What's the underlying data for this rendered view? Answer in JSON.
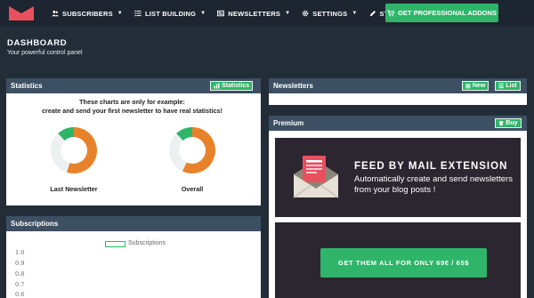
{
  "nav": {
    "items": [
      {
        "label": "SUBSCRIBERS",
        "icon": "users-icon",
        "has_caret": true
      },
      {
        "label": "LIST BUILDING",
        "icon": "list-icon",
        "has_caret": true
      },
      {
        "label": "NEWSLETTERS",
        "icon": "newspaper-icon",
        "has_caret": true
      },
      {
        "label": "SETTINGS",
        "icon": "gear-icon",
        "has_caret": true
      },
      {
        "label": "STATUS",
        "icon": "pencil-icon",
        "has_caret": false
      }
    ],
    "pro_button": "GET PROFESSIONAL ADDONS"
  },
  "header": {
    "title": "DASHBOARD",
    "subtitle": "Your powerful control panel"
  },
  "statistics": {
    "title": "Statistics",
    "button": "Statistics",
    "note_line1": "These charts are only for example:",
    "note_line2": "create and send your first newsletter to have real statistics!",
    "charts": [
      {
        "label": "Last Newsletter",
        "segments": [
          {
            "value": 0.55,
            "color": "#e8822a"
          },
          {
            "value": 0.33,
            "color": "#edf0f1"
          },
          {
            "value": 0.12,
            "color": "#2fb56a"
          }
        ]
      },
      {
        "label": "Overall",
        "segments": [
          {
            "value": 0.57,
            "color": "#e8822a"
          },
          {
            "value": 0.31,
            "color": "#edf0f1"
          },
          {
            "value": 0.12,
            "color": "#2fb56a"
          }
        ]
      }
    ]
  },
  "subscriptions": {
    "title": "Subscriptions",
    "legend": "Subscriptions",
    "yticks": [
      "1.0",
      "0.9",
      "0.8",
      "0.7",
      "0.6"
    ]
  },
  "newsletters": {
    "title": "Newsletters",
    "new_button": "New",
    "list_button": "List"
  },
  "premium": {
    "title": "Premium",
    "buy_button": "Buy",
    "promo_title": "FEED BY MAIL EXTENSION",
    "promo_text": "Automatically create and send newsletters from your blog posts !",
    "cta": "GET THEM ALL FOR ONLY 69€ / 65$"
  },
  "colors": {
    "accent": "#2fb56a",
    "brand": "#e9505e",
    "orange": "#e8822a"
  }
}
